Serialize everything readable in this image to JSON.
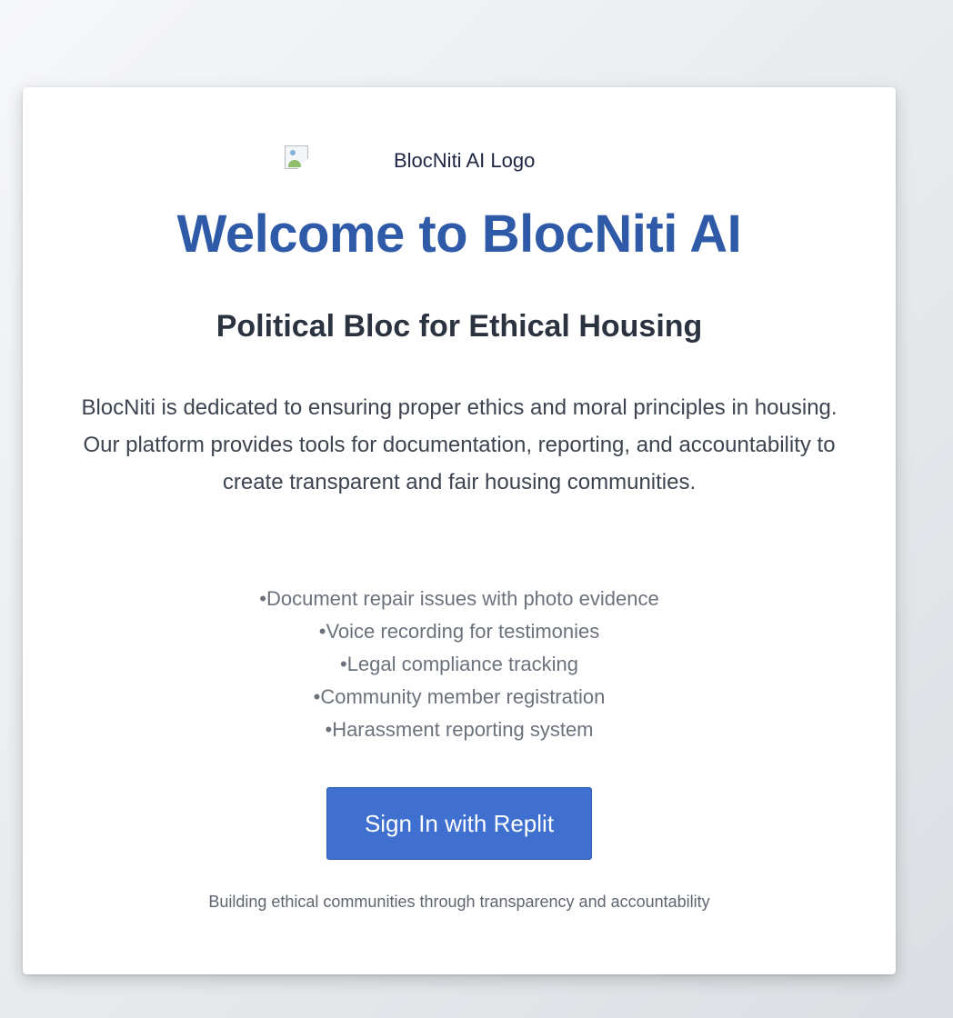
{
  "logo": {
    "alt": "BlocNiti AI Logo",
    "icon": "broken-image-icon"
  },
  "hero": {
    "title": "Welcome to BlocNiti AI",
    "subtitle": "Political Bloc for Ethical Housing",
    "description": "BlocNiti is dedicated to ensuring proper ethics and moral principles in housing. Our platform provides tools for documentation, reporting, and accountability to create transparent and fair housing communities."
  },
  "features": [
    "Document repair issues with photo evidence",
    "Voice recording for testimonies",
    "Legal compliance tracking",
    "Community member registration",
    "Harassment reporting system"
  ],
  "signin": {
    "label": "Sign In with Replit"
  },
  "footer": {
    "tagline": "Building ethical communities through transparency and accountability"
  },
  "colors": {
    "title": "#2e5aa8",
    "button": "#3f70cf",
    "background": "#e6e8ec"
  }
}
